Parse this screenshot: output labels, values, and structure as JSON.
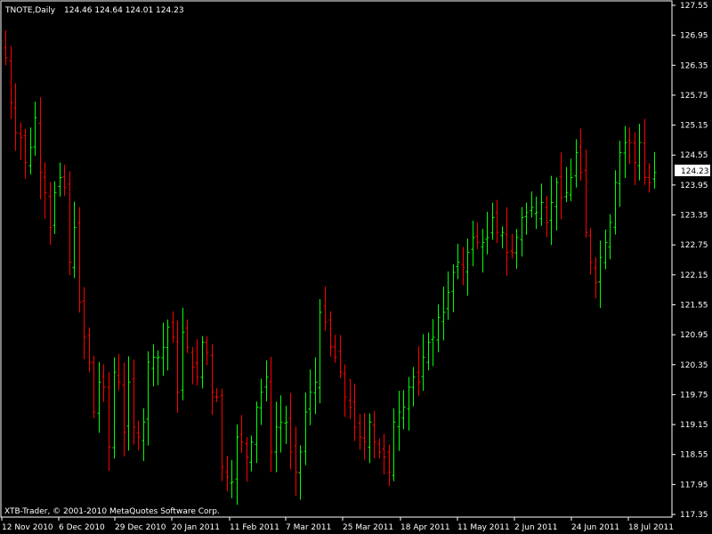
{
  "header": {
    "symbol": "TNOTE,Daily",
    "ohlc": "124.46 124.64 124.01 124.23"
  },
  "footer": {
    "copyright": "XTB-Trader, © 2001-2010 MetaQuotes Software Corp."
  },
  "colors": {
    "background": "#000000",
    "frame": "#ffffff",
    "up_bar": "#00ff00",
    "down_bar": "#ff0000",
    "text": "#ffffff",
    "price_marker_bg": "#ffffff"
  },
  "chart_data": {
    "type": "ohlc",
    "title": "TNOTE,Daily",
    "ylim": [
      117.35,
      127.55
    ],
    "y_ticks": [
      "127.55",
      "126.95",
      "126.35",
      "125.75",
      "125.15",
      "124.55",
      "123.95",
      "123.35",
      "122.75",
      "122.15",
      "121.55",
      "120.95",
      "120.35",
      "119.75",
      "119.15",
      "118.55",
      "117.95",
      "117.35"
    ],
    "x_tick_labels": [
      "12 Nov 2010",
      "6 Dec 2010",
      "29 Dec 2010",
      "20 Jan 2011",
      "11 Feb 2011",
      "7 Mar 2011",
      "25 Mar 2011",
      "18 Apr 2011",
      "11 May 2011",
      "2 Jun 2011",
      "24 Jun 2011",
      "18 Jul 2011"
    ],
    "current_price": "124.23",
    "close_series": [
      126.5,
      125.6,
      125.0,
      124.9,
      124.4,
      124.7,
      125.3,
      124.2,
      123.8,
      123.1,
      123.8,
      124.1,
      123.9,
      122.4,
      123.1,
      121.6,
      120.9,
      120.4,
      119.4,
      120.0,
      119.9,
      118.7,
      120.2,
      120.0,
      119.0,
      120.0,
      119.1,
      118.9,
      119.2,
      120.4,
      120.5,
      120.5,
      120.7,
      121.1,
      120.9,
      119.8,
      121.0,
      120.7,
      120.3,
      120.1,
      120.8,
      120.6,
      119.8,
      119.7,
      118.3,
      118.1,
      118.0,
      118.9,
      118.8,
      118.5,
      118.8,
      119.5,
      119.8,
      120.1,
      118.6,
      119.1,
      119.2,
      119.2,
      118.6,
      118.2,
      118.6,
      119.4,
      119.8,
      120.0,
      121.4,
      121.2,
      120.7,
      120.5,
      120.2,
      119.7,
      119.5,
      119.1,
      118.9,
      118.8,
      119.2,
      118.8,
      118.6,
      118.5,
      118.2,
      119.2,
      119.4,
      119.5,
      119.9,
      120.1,
      120.0,
      120.5,
      120.8,
      120.9,
      121.3,
      121.4,
      121.8,
      122.2,
      122.4,
      122.3,
      122.6,
      122.9,
      122.8,
      122.8,
      122.9,
      123.3,
      123.0,
      123.0,
      122.6,
      122.6,
      122.9,
      123.3,
      123.4,
      123.5,
      123.4,
      123.6,
      123.2,
      123.6,
      124.0,
      123.7,
      123.8,
      124.1,
      124.6,
      124.2,
      123.0,
      122.4,
      122.0,
      122.5,
      122.8,
      123.2,
      124.0,
      124.6,
      124.8,
      124.8,
      124.4,
      124.8,
      124.1,
      124.0,
      124.2
    ],
    "series": [
      {
        "name": "bullish",
        "color": "#00ff00"
      },
      {
        "name": "bearish",
        "color": "#ff0000"
      }
    ]
  }
}
